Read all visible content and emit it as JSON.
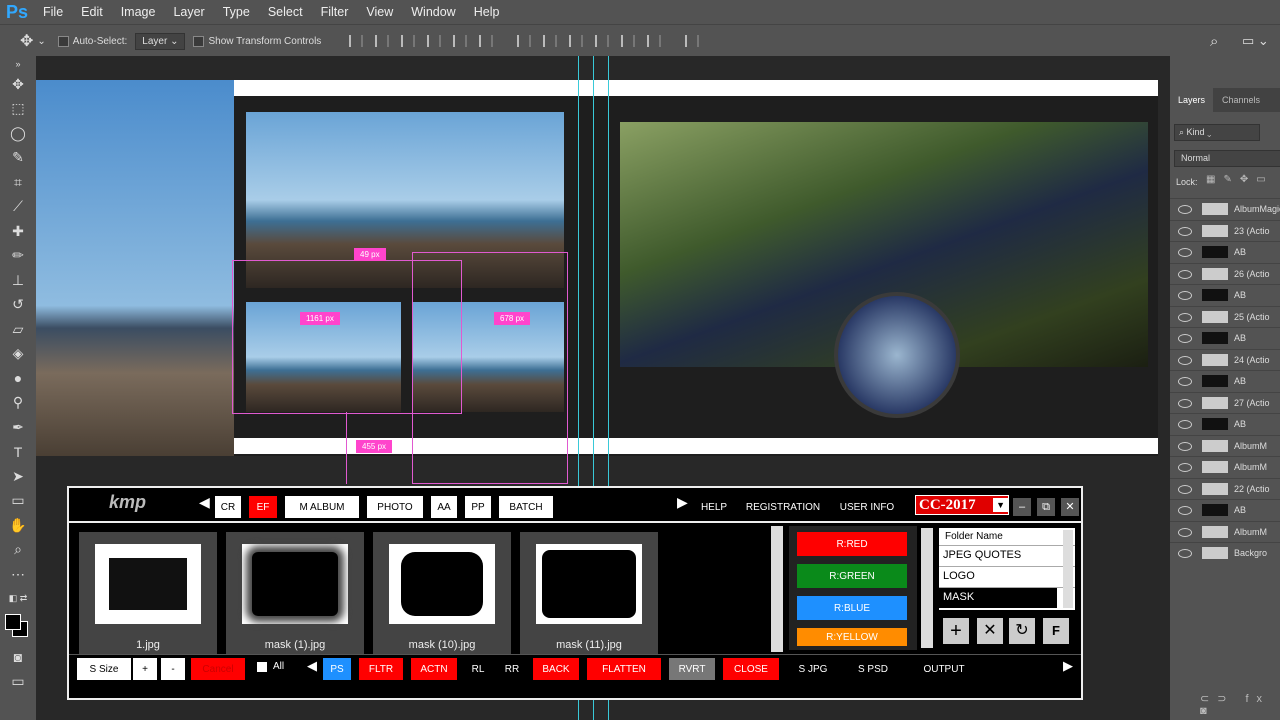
{
  "menu": [
    "File",
    "Edit",
    "Image",
    "Layer",
    "Type",
    "Select",
    "Filter",
    "View",
    "Window",
    "Help"
  ],
  "app_logo": "Ps",
  "options": {
    "auto_select": "Auto-Select:",
    "auto_select_value": "Layer",
    "transform_controls": "Show Transform Controls"
  },
  "measurements": {
    "top": "49 px",
    "left": "1161 px",
    "right": "678 px",
    "bottom": "455 px"
  },
  "plugin": {
    "logo": "kmp",
    "top_buttons": [
      "CR",
      "EF",
      "M ALBUM",
      "PHOTO",
      "AA",
      "PP",
      "BATCH"
    ],
    "top_links": [
      "HELP",
      "REGISTRATION",
      "USER INFO"
    ],
    "version": "CC-2017",
    "thumbs": [
      "1.jpg",
      "mask (1).jpg",
      "mask (10).jpg",
      "mask (11).jpg"
    ],
    "color_buttons": [
      "R:RED",
      "R:GREEN",
      "R:BLUE",
      "R:YELLOW"
    ],
    "folder_header": "Folder Name",
    "folders": [
      "JPEG QUOTES",
      "LOGO",
      "MASK"
    ],
    "bottom_buttons": [
      "S Size",
      "+",
      "-",
      "Cancel",
      "All",
      "PS",
      "FLTR",
      "ACTN",
      "RL",
      "RR",
      "BACK",
      "FLATTEN",
      "RVRT",
      "CLOSE",
      "S JPG",
      "S PSD",
      "OUTPUT"
    ]
  },
  "layers_panel": {
    "tabs": [
      "Layers",
      "Channels"
    ],
    "kind": "Kind",
    "blend": "Normal",
    "lock": "Lock:",
    "rows": [
      "AlbumMagic",
      "23 (Actio",
      "AB",
      "26 (Actio",
      "AB",
      "25 (Actio",
      "AB",
      "24 (Actio",
      "AB",
      "27 (Actio",
      "AB",
      "AlbumM",
      "AlbumM",
      "22 (Actio",
      "AB",
      "AlbumM",
      "Backgro"
    ]
  }
}
